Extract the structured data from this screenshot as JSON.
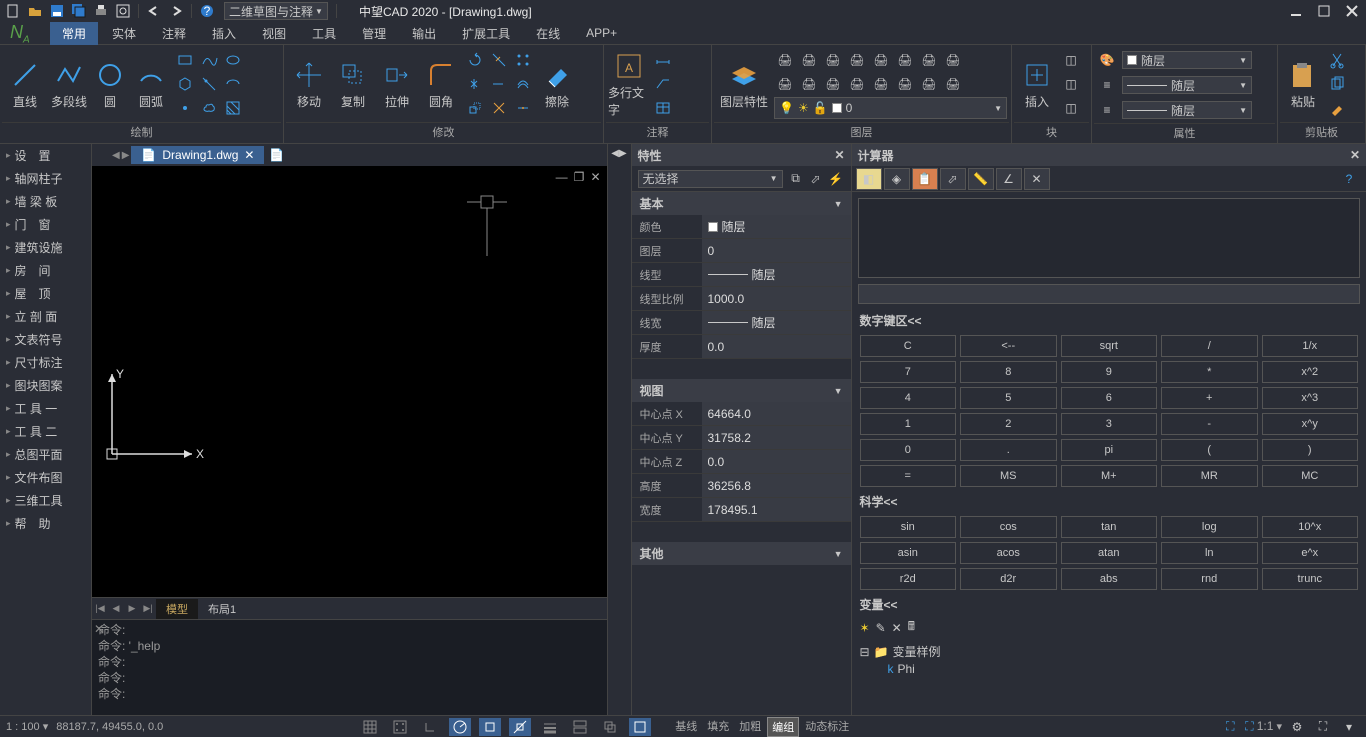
{
  "app": {
    "title": "中望CAD 2020 - [Drawing1.dwg]",
    "workspace": "二维草图与注释"
  },
  "menu": [
    "常用",
    "实体",
    "注释",
    "插入",
    "视图",
    "工具",
    "管理",
    "输出",
    "扩展工具",
    "在线",
    "APP+"
  ],
  "active_menu": 0,
  "ribbon": {
    "draw": {
      "title": "绘制",
      "line": "直线",
      "polyline": "多段线",
      "circle": "圆",
      "arc": "圆弧"
    },
    "modify": {
      "title": "修改",
      "move": "移动",
      "copy": "复制",
      "stretch": "拉伸",
      "fillet": "圆角",
      "erase": "擦除"
    },
    "annotation": {
      "title": "注释",
      "mtext": "多行文字"
    },
    "layer": {
      "title": "图层",
      "props": "图层特性",
      "current": "0"
    },
    "block": {
      "title": "块",
      "insert": "插入"
    },
    "properties": {
      "title": "属性",
      "color": "随层",
      "linetype": "随层",
      "lineweight": "随层"
    },
    "clipboard": {
      "title": "剪贴板",
      "paste": "粘贴"
    }
  },
  "doc_tab": "Drawing1.dwg",
  "left_panel": [
    "设　置",
    "轴网柱子",
    "墙 梁 板",
    "门　窗",
    "建筑设施",
    "房　间",
    "屋　顶",
    "立 剖 面",
    "文表符号",
    "尺寸标注",
    "图块图案",
    "工 具 一",
    "工 具 二",
    "总图平面",
    "文件布图",
    "三维工具",
    "帮　助"
  ],
  "model_tabs": [
    "模型",
    "布局1"
  ],
  "cmd": {
    "prompt": "命令:",
    "lines": [
      "命令:",
      "命令: '_help",
      "命令:",
      "命令:",
      "命令:"
    ]
  },
  "properties_panel": {
    "title": "特性",
    "selection": "无选择",
    "sections": {
      "basic": {
        "title": "基本",
        "rows": [
          {
            "k": "颜色",
            "v": "随层",
            "swatch": "#ffffff"
          },
          {
            "k": "图层",
            "v": "0"
          },
          {
            "k": "线型",
            "v": "随层",
            "line": true
          },
          {
            "k": "线型比例",
            "v": "1000.0"
          },
          {
            "k": "线宽",
            "v": "随层",
            "line": true
          },
          {
            "k": "厚度",
            "v": "0.0"
          }
        ]
      },
      "view": {
        "title": "视图",
        "rows": [
          {
            "k": "中心点 X",
            "v": "64664.0"
          },
          {
            "k": "中心点 Y",
            "v": "31758.2"
          },
          {
            "k": "中心点 Z",
            "v": "0.0"
          },
          {
            "k": "高度",
            "v": "36256.8"
          },
          {
            "k": "宽度",
            "v": "178495.1"
          }
        ]
      },
      "other": {
        "title": "其他"
      }
    }
  },
  "calculator": {
    "title": "计算器",
    "num_section": "数字键区<<",
    "num_keys": [
      [
        "C",
        "<--",
        "sqrt",
        "/",
        "1/x"
      ],
      [
        "7",
        "8",
        "9",
        "*",
        "x^2"
      ],
      [
        "4",
        "5",
        "6",
        "+",
        "x^3"
      ],
      [
        "1",
        "2",
        "3",
        "-",
        "x^y"
      ],
      [
        "0",
        ".",
        "pi",
        "(",
        ")"
      ],
      [
        "=",
        "MS",
        "M+",
        "MR",
        "MC"
      ]
    ],
    "sci_section": "科学<<",
    "sci_keys": [
      [
        "sin",
        "cos",
        "tan",
        "log",
        "10^x"
      ],
      [
        "asin",
        "acos",
        "atan",
        "ln",
        "e^x"
      ],
      [
        "r2d",
        "d2r",
        "abs",
        "rnd",
        "trunc"
      ]
    ],
    "var_section": "变量<<",
    "var_root": "变量样例",
    "var_child": "Phi"
  },
  "status": {
    "scale": "1 : 100 ▾",
    "coords": "88187.7, 49455.0, 0.0",
    "osnap_modes": [
      "基线",
      "填充",
      "加粗",
      "编组",
      "动态标注"
    ],
    "active_mode": 3,
    "anno_scale": "1:1"
  },
  "ucs": {
    "x": "X",
    "y": "Y"
  }
}
